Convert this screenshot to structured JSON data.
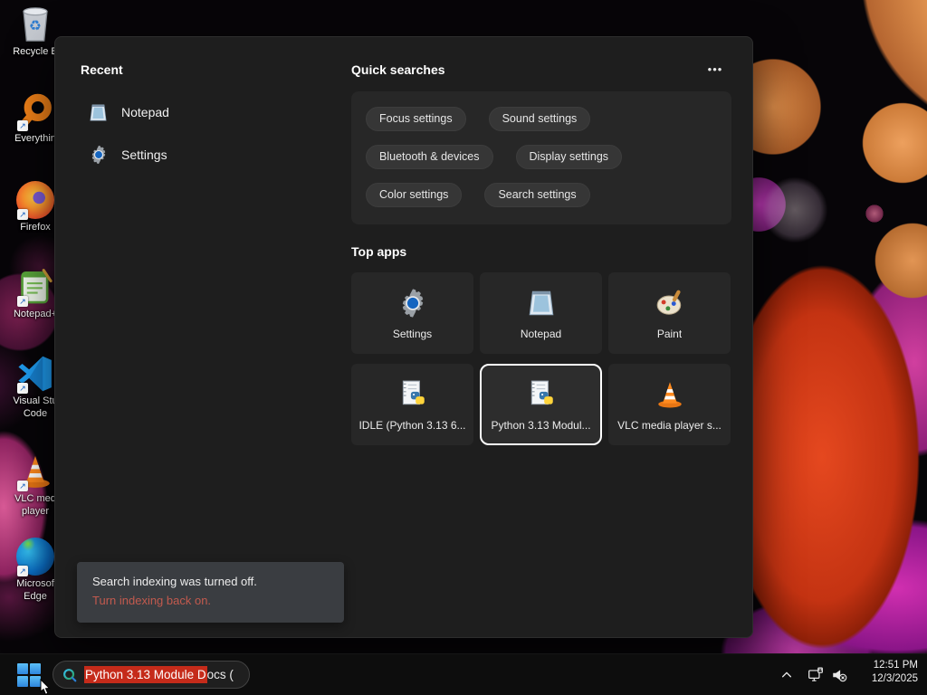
{
  "desktop": {
    "icons": [
      {
        "name": "recycle-bin",
        "label1": "Recycle B",
        "label2": ""
      },
      {
        "name": "everything",
        "label1": "Everythin",
        "label2": ""
      },
      {
        "name": "firefox",
        "label1": "Firefox",
        "label2": ""
      },
      {
        "name": "notepad-plus-plus",
        "label1": "Notepad+",
        "label2": ""
      },
      {
        "name": "visual-studio-code",
        "label1": "Visual Stu",
        "label2": "Code"
      },
      {
        "name": "vlc-media-player",
        "label1": "VLC med",
        "label2": "player"
      },
      {
        "name": "microsoft-edge",
        "label1": "Microsof",
        "label2": "Edge"
      }
    ]
  },
  "panel": {
    "recent": {
      "title": "Recent",
      "items": [
        {
          "label": "Notepad",
          "icon": "notepad-icon"
        },
        {
          "label": "Settings",
          "icon": "settings-gear-icon"
        }
      ]
    },
    "quick": {
      "title": "Quick searches",
      "more_icon": "•••",
      "pills": [
        "Focus settings",
        "Sound settings",
        "Bluetooth & devices",
        "Display settings",
        "Color settings",
        "Search settings"
      ]
    },
    "top_apps": {
      "title": "Top apps",
      "tiles": [
        {
          "label": "Settings",
          "icon": "settings-gear-icon",
          "selected": false
        },
        {
          "label": "Notepad",
          "icon": "notepad-icon",
          "selected": false
        },
        {
          "label": "Paint",
          "icon": "paint-palette-icon",
          "selected": false
        },
        {
          "label": "IDLE (Python 3.13 6...",
          "icon": "python-doc-icon",
          "selected": false
        },
        {
          "label": "Python 3.13 Modul...",
          "icon": "python-doc-icon",
          "selected": true
        },
        {
          "label": "VLC media player s...",
          "icon": "vlc-cone-icon",
          "selected": false
        }
      ]
    },
    "notice": {
      "message": "Search indexing was turned off.",
      "link": "Turn indexing back on."
    }
  },
  "taskbar": {
    "search_highlight": "Python 3.13 Module D",
    "search_rest": "ocs (",
    "clock": {
      "time": "12:51 PM",
      "date": "12/3/2025"
    }
  },
  "colors": {
    "search_selection_red": "#c52b1a",
    "notice_link_red": "#c25a4e",
    "start_logo_blue": "#3d9be9",
    "panel_background": "#1e1e1e"
  }
}
